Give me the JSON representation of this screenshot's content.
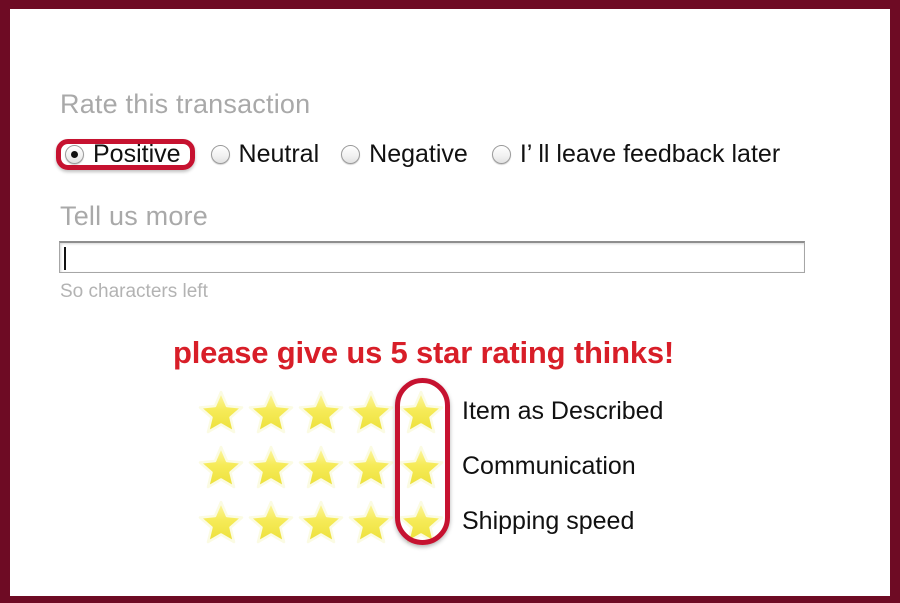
{
  "frame": {
    "border_color": "#6e0b24",
    "background": "#ffffff"
  },
  "rate_section": {
    "heading": "Rate this transaction",
    "heading_color": "#a9a9a9",
    "options": [
      {
        "label": "Positive",
        "checked": true,
        "highlighted": true
      },
      {
        "label": "Neutral",
        "checked": false,
        "highlighted": false
      },
      {
        "label": "Negative",
        "checked": false,
        "highlighted": false
      },
      {
        "label": "I’  ll leave feedback later",
        "checked": false,
        "highlighted": false
      }
    ]
  },
  "tell_us_section": {
    "heading": "Tell us more",
    "input_value": "",
    "input_placeholder": "",
    "char_counter": "So characters left"
  },
  "promo": {
    "text": "please give us 5 star rating thinks!",
    "color": "#d81e28"
  },
  "ratings": {
    "star_count": 5,
    "highlight_color": "#c61230",
    "star_color": "#f3e64b",
    "rows": [
      {
        "label": "Item as Described",
        "value": 5
      },
      {
        "label": "Communication",
        "value": 5
      },
      {
        "label": "Shipping speed",
        "value": 5
      }
    ]
  }
}
